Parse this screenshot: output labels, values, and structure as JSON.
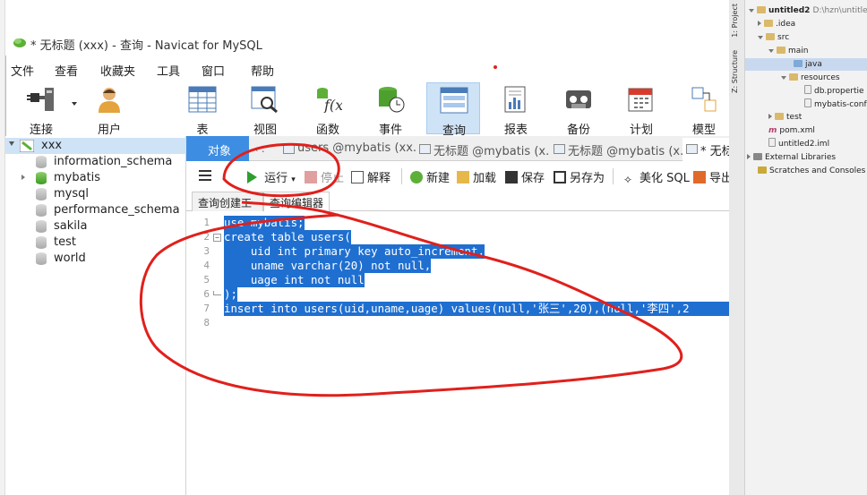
{
  "window": {
    "title": "* 无标题 (xxx) - 查询 - Navicat for MySQL"
  },
  "menu": [
    "文件",
    "查看",
    "收藏夹",
    "工具",
    "窗口",
    "帮助"
  ],
  "toolbar": [
    "连接",
    "用户",
    "表",
    "视图",
    "函数",
    "事件",
    "查询",
    "报表",
    "备份",
    "计划",
    "模型"
  ],
  "sidebar": {
    "connection": "xxx",
    "databases": [
      "information_schema",
      "mybatis",
      "mysql",
      "performance_schema",
      "sakila",
      "test",
      "world"
    ]
  },
  "tabs": {
    "object_tab": "对象",
    "items": [
      "users @mybatis (xx...",
      "无标题 @mybatis (x...",
      "无标题 @mybatis (x...",
      "* 无标"
    ]
  },
  "query_toolbar": [
    "运行",
    "停止",
    "解释",
    "新建",
    "加载",
    "保存",
    "另存为",
    "美化 SQL",
    "导出"
  ],
  "subtabs": [
    "查询创建工具",
    "查询编辑器"
  ],
  "editor": {
    "line_numbers": [
      "1",
      "2",
      "3",
      "4",
      "5",
      "6",
      "7",
      "8"
    ],
    "lines": [
      "use mybatis;",
      "create table users(",
      "    uid int primary key auto_increment,",
      "    uname varchar(20) not null,",
      "    uage int not null",
      ");",
      "insert into users(uid,uname,uage) values(null,'张三',20),(null,'李四',2"
    ]
  },
  "ide": {
    "side_tabs": [
      "1: Project",
      "Z: Structure"
    ],
    "tree": [
      {
        "label": "untitled2",
        "extra": "D:\\hzn\\untitled"
      },
      {
        "label": ".idea"
      },
      {
        "label": "src"
      },
      {
        "label": "main"
      },
      {
        "label": "java"
      },
      {
        "label": "resources"
      },
      {
        "label": "db.propertie"
      },
      {
        "label": "mybatis-conf"
      },
      {
        "label": "test"
      },
      {
        "label": "pom.xml"
      },
      {
        "label": "untitled2.iml"
      },
      {
        "label": "External Libraries"
      },
      {
        "label": "Scratches and Consoles"
      }
    ]
  },
  "annotation_color": "#e0201c",
  "accent": "#3d8ee2"
}
